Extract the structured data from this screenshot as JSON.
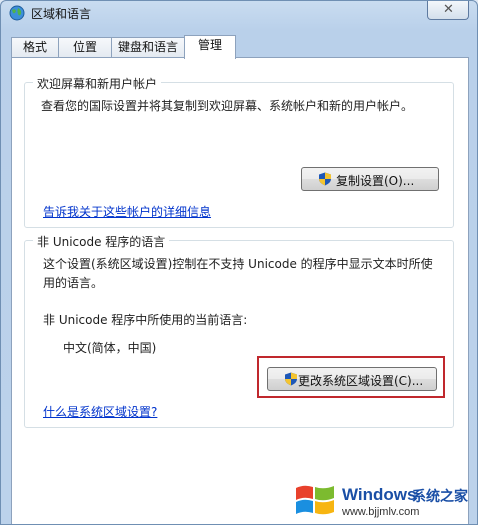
{
  "window": {
    "title": "区域和语言",
    "close_symbol": "✕"
  },
  "tabs": [
    {
      "label": "格式"
    },
    {
      "label": "位置"
    },
    {
      "label": "键盘和语言"
    },
    {
      "label": "管理"
    }
  ],
  "welcome_group": {
    "title": "欢迎屏幕和新用户帐户",
    "description": "查看您的国际设置并将其复制到欢迎屏幕、系统帐户和新的用户帐户。",
    "copy_button": "复制设置(O)...",
    "link": "告诉我关于这些帐户的详细信息"
  },
  "unicode_group": {
    "title": "非 Unicode 程序的语言",
    "description_line1": "这个设置(系统区域设置)控制在不支持 Unicode 的程序中显示文本时所使",
    "description_line2": "用的语言。",
    "current_label": "非 Unicode 程序中所使用的当前语言:",
    "current_value": "中文(简体，中国)",
    "change_button": "更改系统区域设置(C)...",
    "link": "什么是系统区域设置?"
  },
  "watermark": {
    "brand": "Windows",
    "cn": "系统之家",
    "url": "www.bjjmlv.com"
  },
  "icons": {
    "title": "globe-icon",
    "shield": "uac-shield-icon",
    "logo": "windows-logo-icon"
  },
  "colors": {
    "highlight": "#c0282d",
    "link": "#0033cc"
  }
}
